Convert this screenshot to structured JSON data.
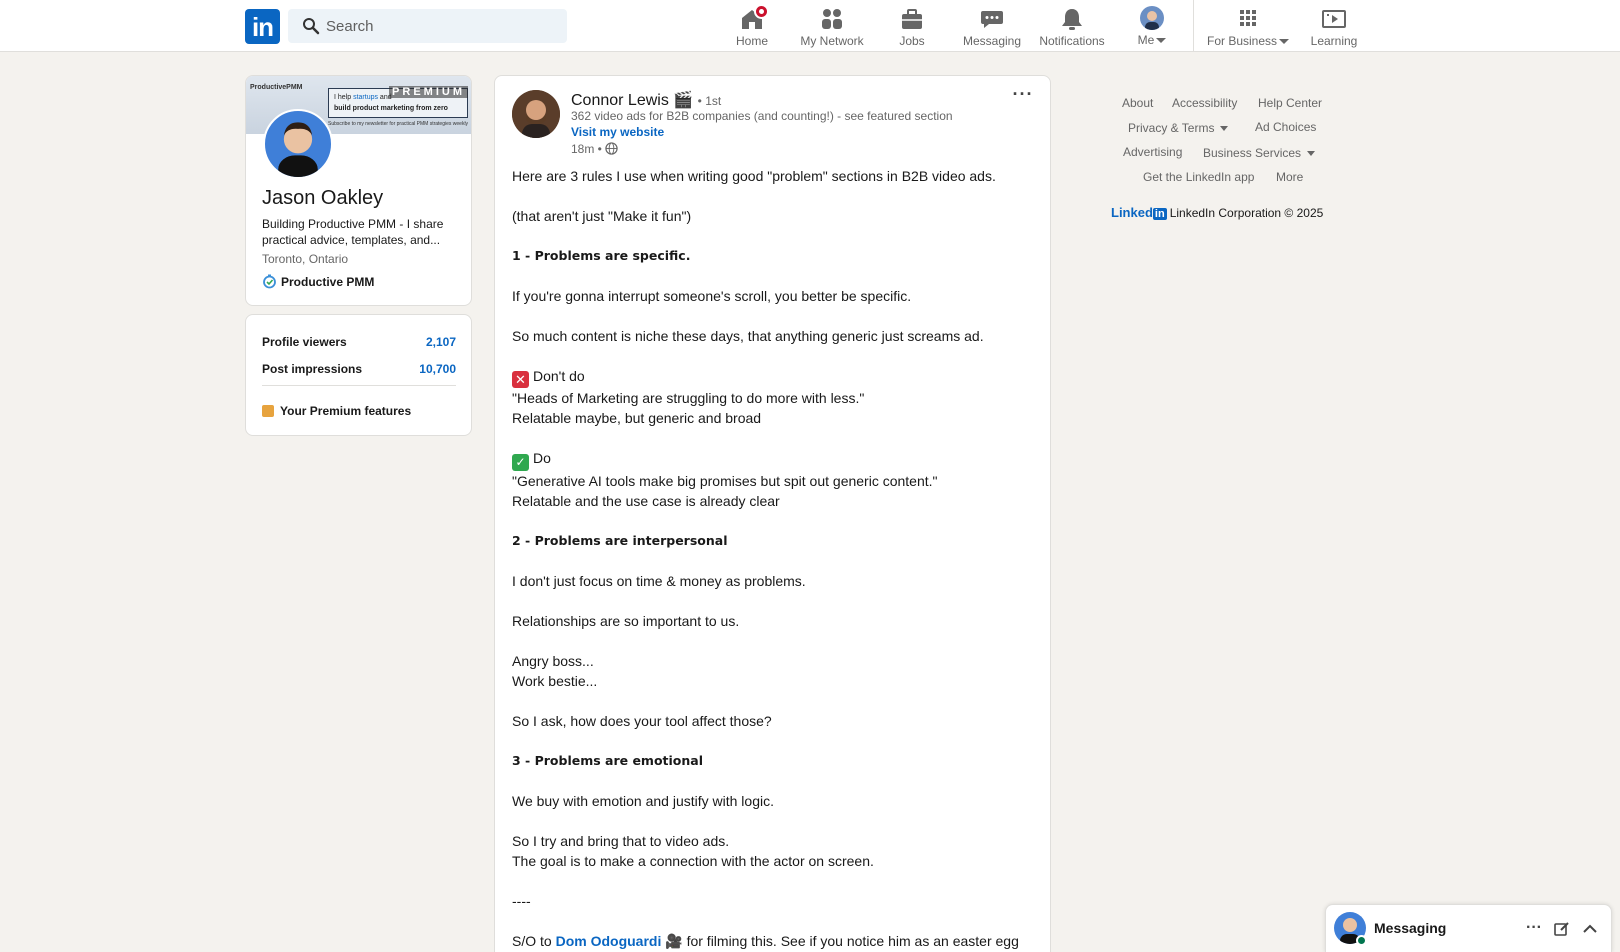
{
  "search": {
    "placeholder": "Search"
  },
  "nav": {
    "home": "Home",
    "network": "My Network",
    "jobs": "Jobs",
    "messaging": "Messaging",
    "notifications": "Notifications",
    "me": "Me",
    "business": "For Business",
    "learning": "Learning"
  },
  "profile": {
    "banner_logo": "ProductivePMM",
    "banner_line1_a": "I help ",
    "banner_line1_b": "startups",
    "banner_line1_c": " and",
    "banner_line2": "build product marketing from zero",
    "banner_sub": "Subscribe to my newsletter for practical PMM strategies weekly",
    "premium": "PREMIUM",
    "name": "Jason Oakley",
    "headline": "Building Productive PMM - I share practical advice, templates, and...",
    "location": "Toronto, Ontario",
    "company": "Productive PMM"
  },
  "stats": {
    "viewers_label": "Profile viewers",
    "viewers_value": "2,107",
    "impressions_label": "Post impressions",
    "impressions_value": "10,700",
    "premium_features": "Your Premium features"
  },
  "post": {
    "author_name": "Connor Lewis",
    "author_emoji": "🎬",
    "degree": "• 1st",
    "author_headline": "362 video ads for B2B companies (and counting!) - see featured section",
    "website": "Visit my website",
    "time": "18m •",
    "more": "···",
    "lines": {
      "l1": "Here are 3 rules I use when writing good \"problem\" sections in B2B video ads.",
      "l2": "(that aren't just \"Make it fun\")",
      "l3": "1 - Problems are specific.",
      "l4": "If you're gonna interrupt someone's scroll, you better be specific.",
      "l5": "So much content is niche these days, that anything generic just screams ad.",
      "l6": "Don't do",
      "l7": "\"Heads of Marketing are struggling to do more with less.\"",
      "l8": "Relatable maybe, but generic and broad",
      "l9": "Do",
      "l10": "\"Generative AI tools make big promises but spit out generic content.\"",
      "l11": "Relatable and the use case is already clear",
      "l12": "2 - Problems are interpersonal",
      "l13": "I don't just focus on time & money as problems.",
      "l14": "Relationships are so important to us.",
      "l15": "Angry boss...",
      "l16": "Work bestie...",
      "l17": "So I ask, how does your tool affect those?",
      "l18": "3 - Problems are emotional",
      "l19": "We buy with emotion and justify with logic.",
      "l20": "So I try and bring that to video ads.",
      "l21": "The goal is to make a connection with the actor on screen.",
      "l22": "----",
      "l23a": "S/O to ",
      "l23b": "Dom Odoguardi",
      "l23c": " 🎥 for filming this. See if you notice him as an easter egg"
    }
  },
  "footer": {
    "about": "About",
    "accessibility": "Accessibility",
    "help": "Help Center",
    "privacy": "Privacy & Terms",
    "adchoices": "Ad Choices",
    "advertising": "Advertising",
    "business": "Business Services",
    "app": "Get the LinkedIn app",
    "more": "More",
    "brand_word": "Linked",
    "brand_box": "in",
    "copyright": "LinkedIn Corporation © 2025"
  },
  "messaging": {
    "title": "Messaging"
  },
  "colors": {
    "brand": "#0a66c2",
    "badge": "#cb112d",
    "background": "#f4f2ee"
  },
  "icons": [
    "search-icon",
    "home-icon",
    "network-icon",
    "jobs-icon",
    "messaging-icon",
    "bell-icon",
    "grid-icon",
    "learning-icon",
    "globe-icon",
    "compose-icon",
    "chevron-up-icon"
  ]
}
